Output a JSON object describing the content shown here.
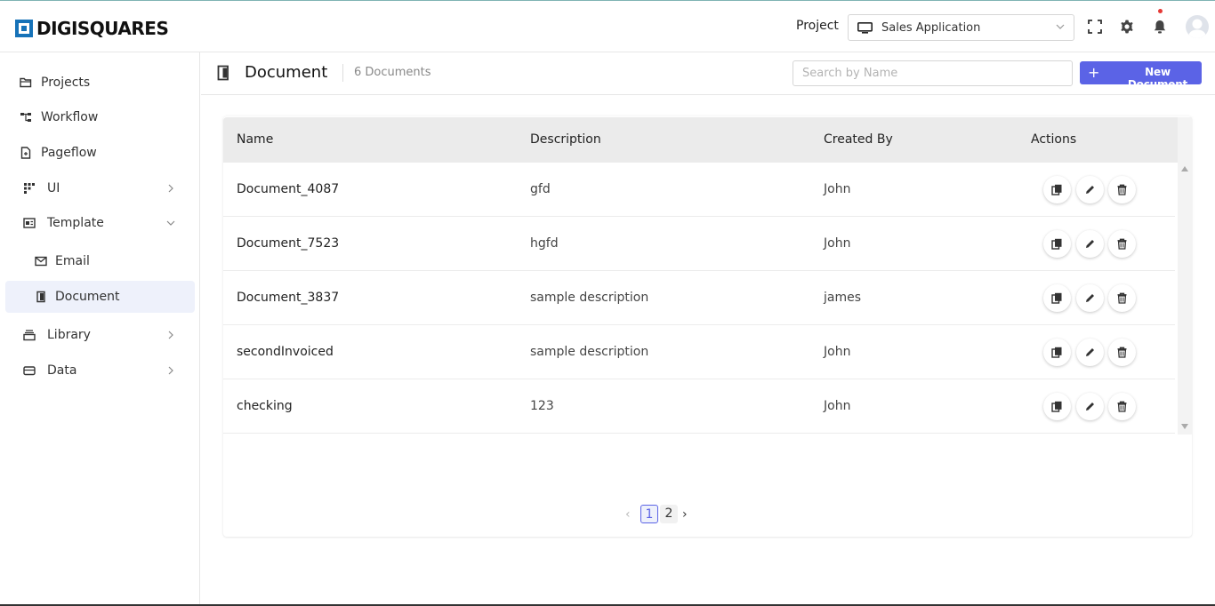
{
  "app": {
    "brand": "DIGISQUARES"
  },
  "header": {
    "project_label": "Project",
    "project_value": "Sales Application"
  },
  "sidebar": {
    "items": [
      {
        "label": "Projects"
      },
      {
        "label": "Workflow"
      },
      {
        "label": "Pageflow"
      },
      {
        "label": "UI"
      },
      {
        "label": "Template"
      },
      {
        "label": "Email"
      },
      {
        "label": "Document"
      },
      {
        "label": "Library"
      },
      {
        "label": "Data"
      }
    ]
  },
  "page": {
    "title": "Document",
    "count": "6 Documents",
    "search_placeholder": "Search by Name",
    "new_button": "New Document"
  },
  "table": {
    "columns": [
      "Name",
      "Description",
      "Created By",
      "Actions"
    ],
    "rows": [
      {
        "name": "Document_4087",
        "description": "gfd",
        "created_by": "John"
      },
      {
        "name": "Document_7523",
        "description": "hgfd",
        "created_by": "John"
      },
      {
        "name": "Document_3837",
        "description": "sample description",
        "created_by": "james"
      },
      {
        "name": "secondInvoiced",
        "description": "sample description",
        "created_by": "John"
      },
      {
        "name": "checking",
        "description": "123",
        "created_by": "John"
      }
    ]
  },
  "pagination": {
    "pages": [
      "1",
      "2"
    ],
    "current": "1",
    "prev": "‹",
    "next": "›"
  },
  "colors": {
    "accent": "#5b63e6",
    "brand": "#1672b8",
    "active_bg": "#eef1fb"
  },
  "icons": [
    "folder-icon",
    "workflow-icon",
    "pageflow-icon",
    "ui-icon",
    "template-icon",
    "mail-icon",
    "document-icon",
    "library-icon",
    "data-icon",
    "monitor-icon",
    "fullscreen-icon",
    "gear-icon",
    "bell-icon",
    "avatar-icon",
    "copy-icon",
    "edit-icon",
    "trash-icon"
  ]
}
